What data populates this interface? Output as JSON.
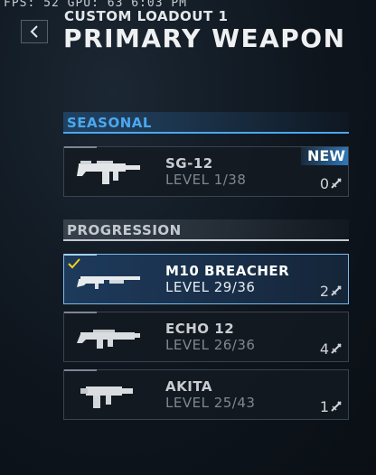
{
  "status_strip": "FPS:  52 GPU: 63    6:03 PM",
  "header": {
    "subtitle": "CUSTOM LOADOUT 1",
    "title": "PRIMARY WEAPON"
  },
  "sections": {
    "seasonal": "SEASONAL",
    "progression": "PROGRESSION"
  },
  "weapons": [
    {
      "name": "SG-12",
      "level": "LEVEL 1/38",
      "attachments": "0",
      "badge": "NEW",
      "selected": false,
      "icon": "sg12-shotgun-icon"
    },
    {
      "name": "M10 BREACHER",
      "level": "LEVEL 29/36",
      "attachments": "2",
      "selected": true,
      "icon": "m10-breacher-shotgun-icon"
    },
    {
      "name": "ECHO 12",
      "level": "LEVEL 26/36",
      "attachments": "4",
      "selected": false,
      "icon": "echo12-shotgun-icon"
    },
    {
      "name": "AKITA",
      "level": "LEVEL 25/43",
      "attachments": "1",
      "selected": false,
      "icon": "akita-shotgun-icon"
    }
  ],
  "colors": {
    "seasonal_accent": "#4aa8ef",
    "selected_border": "#7bb8ea",
    "check_mark": "#f2d21a"
  }
}
